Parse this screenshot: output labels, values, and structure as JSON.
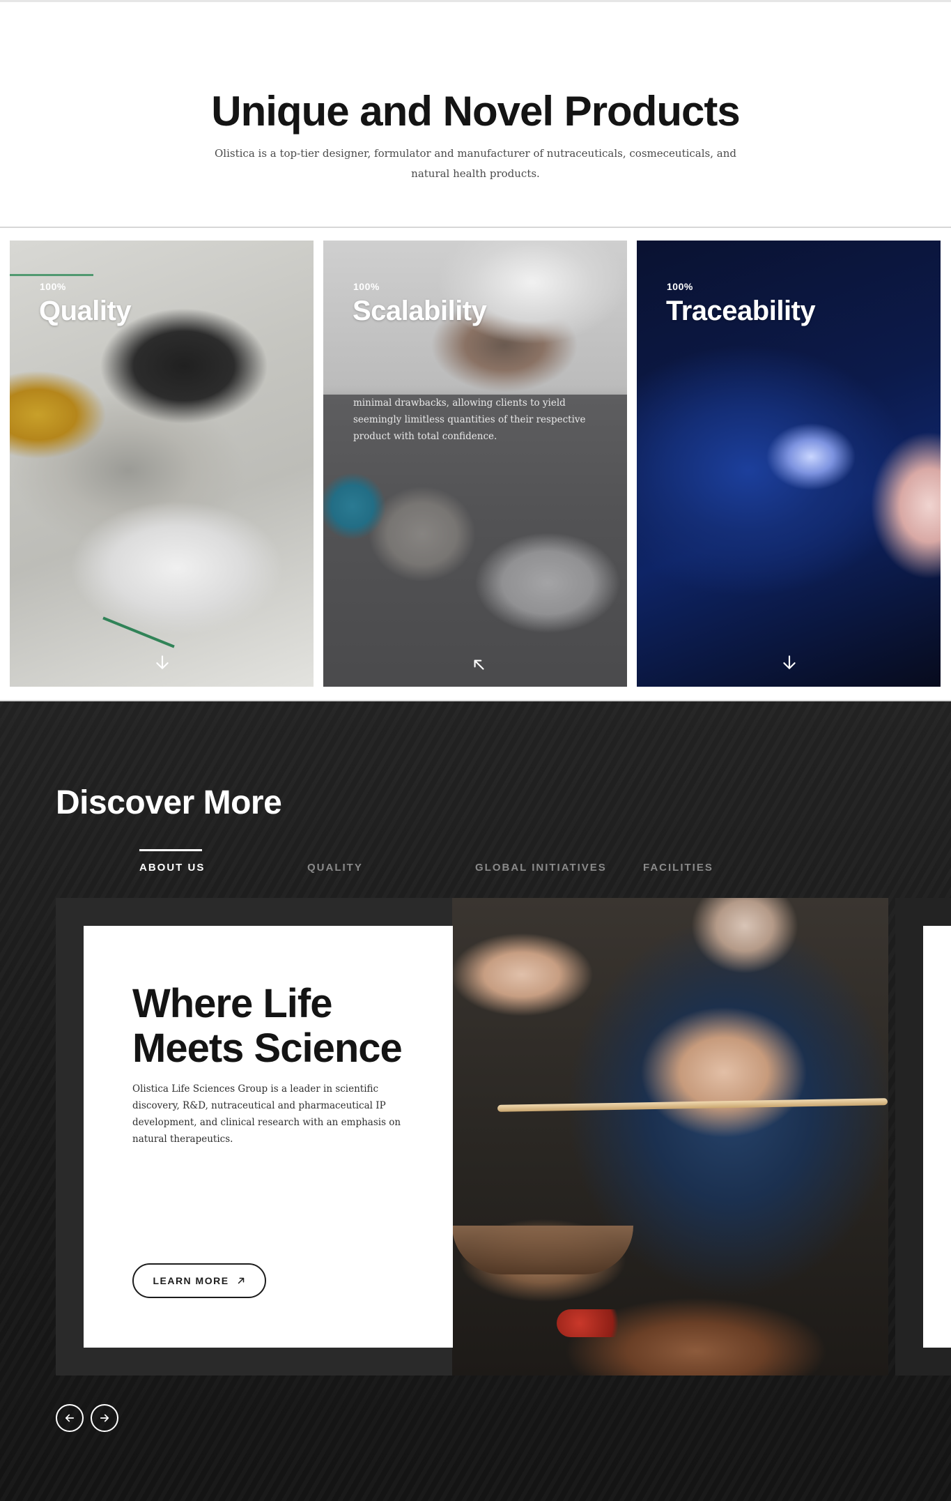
{
  "intro": {
    "title": "Unique and Novel Products",
    "subtitle": "Olistica is a top-tier designer, formulator and manufacturer of nutraceuticals, cosmeceuticals, and natural health products."
  },
  "cards": [
    {
      "badge": "100%",
      "title": "Quality",
      "icon": "arrow-down-icon"
    },
    {
      "badge": "100%",
      "title": "Scalability",
      "body": "minimal drawbacks, allowing clients to yield seemingly limitless quantities of their respective product with total confidence.",
      "icon": "arrow-up-left-icon"
    },
    {
      "badge": "100%",
      "title": "Traceability",
      "icon": "arrow-down-icon"
    }
  ],
  "discover": {
    "title": "Discover More",
    "tabs": [
      {
        "label": "ABOUT US",
        "active": true
      },
      {
        "label": "QUALITY",
        "active": false
      },
      {
        "label": "GLOBAL INITIATIVES",
        "active": false
      },
      {
        "label": "FACILITIES",
        "active": false
      }
    ],
    "slide": {
      "title": "Where Life Meets Science",
      "body": "Olistica Life Sciences Group is a leader in scientific discovery, R&D, nutraceutical and pharmaceutical IP development, and clinical research with an emphasis on natural therapeutics.",
      "button_label": "LEARN MORE",
      "button_icon": "arrow-up-right-icon"
    },
    "nav": {
      "prev_icon": "arrow-left-icon",
      "next_icon": "arrow-right-icon"
    }
  },
  "colors": {
    "background": "#ffffff",
    "dark_section": "#1c1c1c",
    "text_dark": "#141414",
    "tab_inactive": "#8a8a8a"
  }
}
